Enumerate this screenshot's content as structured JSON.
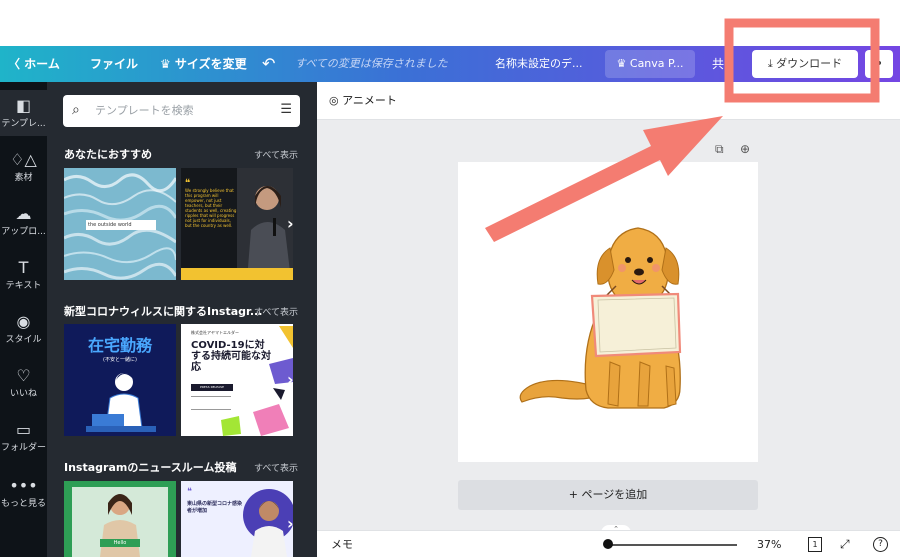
{
  "topbar": {
    "home_label": "〈 ホーム",
    "file_label": "ファイル",
    "resize_label": "♛ サイズを変更",
    "undo_glyph": "↶",
    "saved_status": "すべての変更は保存されました",
    "doc_title": "名称未設定のデ...",
    "pro_label": "♛ Canva P...",
    "share_label": "共",
    "download_label": "ダウンロード",
    "more_glyph": "•"
  },
  "leftnav": {
    "items": [
      {
        "icon": "template-icon",
        "glyph": "◧",
        "label": "テンプレ..."
      },
      {
        "icon": "elements-icon",
        "glyph": "♢△",
        "label": "素材"
      },
      {
        "icon": "upload-icon",
        "glyph": "☁",
        "label": "アップロ..."
      },
      {
        "icon": "text-icon",
        "glyph": "T",
        "label": "テキスト"
      },
      {
        "icon": "style-icon",
        "glyph": "◉",
        "label": "スタイル"
      },
      {
        "icon": "like-icon",
        "glyph": "♡",
        "label": "いいね"
      },
      {
        "icon": "folder-icon",
        "glyph": "▭",
        "label": "フォルダー"
      },
      {
        "icon": "more-icon",
        "glyph": "•••",
        "label": "もっと見る"
      }
    ]
  },
  "panel": {
    "search_placeholder": "テンプレートを検索",
    "sections": [
      {
        "title": "あなたにおすすめ",
        "see_all": "すべて表示"
      },
      {
        "title": "新型コロナウィルスに関するInstagr...",
        "see_all": "すべて表示"
      },
      {
        "title": "Instagramのニュースルーム投稿",
        "see_all": "すべて表示"
      }
    ],
    "thumbs": {
      "t1_text": "the outside world",
      "t2_text": "We strongly believe that this program will empower, not just teachers, but their students as well, creating ripples that will progress not just for individuals, but the country as well.",
      "t3_title": "在宅勤務",
      "t3_sub": "(不安と一緒に)",
      "t4_org": "株式会社アヤマトエルダー",
      "t4_title": "COVID-19に対する持続可能な対応",
      "t4_btn": "PRESS RELEASE",
      "t5_text": "Hello",
      "t6_text": "東山県の新型コロナ感染者が増加"
    }
  },
  "editor": {
    "animate_label": "アニメート",
    "add_page_label": "+ ページを追加",
    "memo_label": "メモ",
    "zoom_level": "37%",
    "zoom_fraction": 0.02,
    "page_count": "1",
    "help_glyph": "?",
    "expand_glyph": "⤢"
  },
  "colors": {
    "highlight": "#f47c71",
    "topbar_start": "#1fb4c9",
    "topbar_end": "#7446e3"
  }
}
